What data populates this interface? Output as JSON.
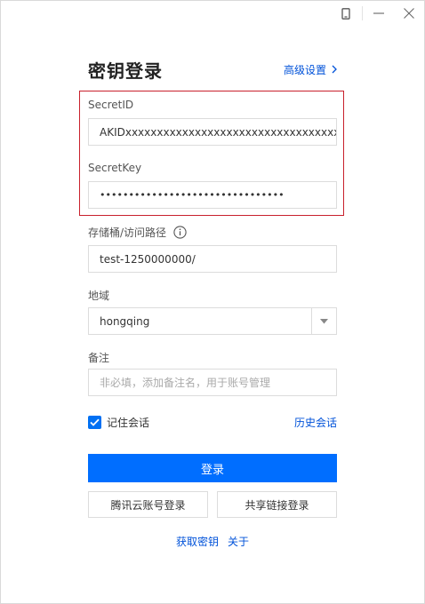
{
  "header": {
    "title": "密钥登录",
    "advanced_label": "高级设置"
  },
  "secret_id": {
    "label": "SecretID",
    "value": "AKIDxxxxxxxxxxxxxxxxxxxxxxxxxxxxxxxxxx"
  },
  "secret_key": {
    "label": "SecretKey",
    "value": "••••••••••••••••••••••••••••••••"
  },
  "bucket": {
    "label": "存储桶/访问路径",
    "value": "test-1250000000/"
  },
  "region": {
    "label": "地域",
    "value": "hongqing"
  },
  "note": {
    "label": "备注",
    "placeholder": "非必填，添加备注名，用于账号管理"
  },
  "remember": {
    "label": "记住会话",
    "checked": true
  },
  "history_label": "历史会话",
  "buttons": {
    "login": "登录",
    "tencent_login": "腾讯云账号登录",
    "share_link_login": "共享链接登录"
  },
  "footer": {
    "get_key": "获取密钥",
    "about": "关于"
  },
  "colors": {
    "primary": "#006eff",
    "link": "#0052d9",
    "highlight_border": "#c8202c"
  }
}
